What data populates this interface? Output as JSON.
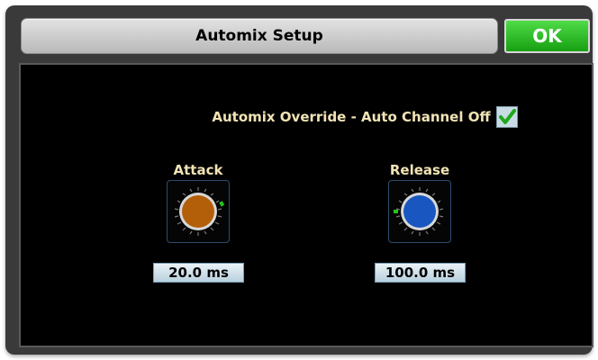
{
  "dialog": {
    "title": "Automix Setup",
    "ok_label": "OK"
  },
  "override": {
    "label": "Automix Override - Auto Channel Off",
    "checked": true
  },
  "attack": {
    "label": "Attack",
    "value": "20.0 ms",
    "knob_color": "#b35f0a"
  },
  "release": {
    "label": "Release",
    "value": "100.0 ms",
    "knob_color": "#1a56c0"
  },
  "colors": {
    "accent_green": "#1fc81a",
    "label_text": "#f1e3b5"
  }
}
